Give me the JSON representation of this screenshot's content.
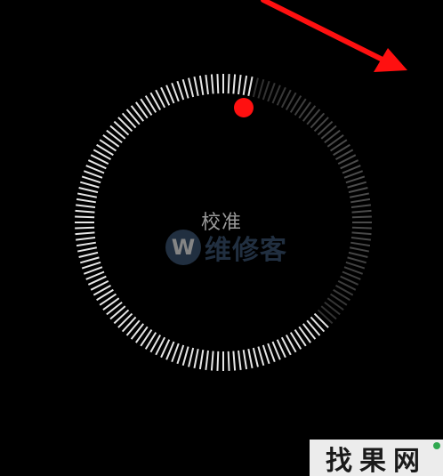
{
  "screen": {
    "background": "#000000"
  },
  "dial": {
    "label": "校准",
    "tick_count": 160,
    "tick_color": "#e6e6e6",
    "dim_tick_color": "#555555",
    "indicator_color": "#ff1010"
  },
  "arrow": {
    "color": "#ff1010"
  },
  "watermark": {
    "badge_letter": "W",
    "text": "维修客",
    "color": "#3d5675"
  },
  "corner_logo": {
    "text": "找果网"
  }
}
